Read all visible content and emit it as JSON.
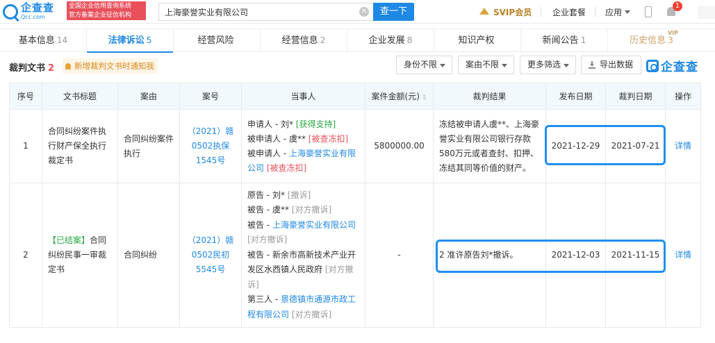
{
  "header": {
    "logo_cn": "企查查",
    "logo_en": "Qcc.com",
    "tagline_1": "全国企业信用查询系统",
    "tagline_2": "官方备案企业征信机构",
    "search_value": "上海豪誉实业有限公司",
    "search_button": "查一下",
    "svip": "SVIP会员",
    "package": "企业套餐",
    "app": "应用",
    "notifications": "1"
  },
  "tabs": [
    {
      "label": "基本信息",
      "count": "14"
    },
    {
      "label": "法律诉讼",
      "count": "5"
    },
    {
      "label": "经营风险",
      "count": ""
    },
    {
      "label": "经营信息",
      "count": "2"
    },
    {
      "label": "企业发展",
      "count": "8"
    },
    {
      "label": "知识产权",
      "count": ""
    },
    {
      "label": "新闻公告",
      "count": "1"
    },
    {
      "label": "历史信息",
      "count": "3",
      "badge": "VIP"
    }
  ],
  "section": {
    "title": "裁判文书",
    "count": "2",
    "notify": "新增裁判文书时通知我",
    "filter_identity": "身份不限",
    "filter_case": "案由不限",
    "filter_more": "更多筛选",
    "export": "导出数据",
    "watermark": "企查查"
  },
  "table": {
    "headers": [
      "序号",
      "文书标题",
      "案由",
      "案号",
      "当事人",
      "案件金额(元)",
      "裁判结果",
      "发布日期",
      "裁判日期",
      "操作"
    ],
    "rows": [
      {
        "index": "1",
        "title": "合同纠纷案件执行财产保全执行裁定书",
        "cause": "合同纠纷案件执行",
        "case_no": "（2021）赣0502执保1545号",
        "parties": [
          {
            "role": "申请人 - 刘*",
            "tag": "[获得支持]",
            "tag_type": "green"
          },
          {
            "role": "被申请人 - 虞**",
            "tag": "[被查冻扣]",
            "tag_type": "red"
          },
          {
            "role": "被申请人 - ",
            "link": "上海豪誉实业有限公司",
            "tag": "[被查冻扣]",
            "tag_type": "red"
          }
        ],
        "amount": "5800000.00",
        "result": "冻结被申请人虞**、上海豪誉实业有限公司银行存款580万元或者查封、扣押、冻结其同等价值的财产。",
        "publish_date": "2021-12-29",
        "judge_date": "2021-07-21",
        "action": "详情"
      },
      {
        "index": "2",
        "title_tag": "【已结案】",
        "title": "合同纠纷民事一审裁定书",
        "cause": "合同纠纷",
        "case_no": "（2021）赣0502民初5545号",
        "parties": [
          {
            "role": "原告 - 刘*",
            "tag": "[撤诉]",
            "tag_type": "grey"
          },
          {
            "role": "被告 - 虞**",
            "tag": "[对方撤诉]",
            "tag_type": "grey"
          },
          {
            "role": "被告 - ",
            "link": "上海豪誉实业有限公司",
            "tag": "[对方撤诉]",
            "tag_type": "grey"
          },
          {
            "role": "被告 - 新余市高新技术产业开发区水西镇人民政府",
            "tag": "[对方撤诉]",
            "tag_type": "grey"
          },
          {
            "role": "第三人 - ",
            "link": "景德镇市通源市政工程有限公司",
            "tag": "[对方撤诉]",
            "tag_type": "grey"
          }
        ],
        "amount": "-",
        "result": "2 准许原告刘*撤诉。",
        "publish_date": "2021-12-03",
        "judge_date": "2021-11-15",
        "action": "详情"
      }
    ]
  },
  "colors": {
    "primary": "#1e88e5",
    "danger": "#e8505b",
    "success": "#2aa844",
    "highlight": "#1e8ff0"
  }
}
